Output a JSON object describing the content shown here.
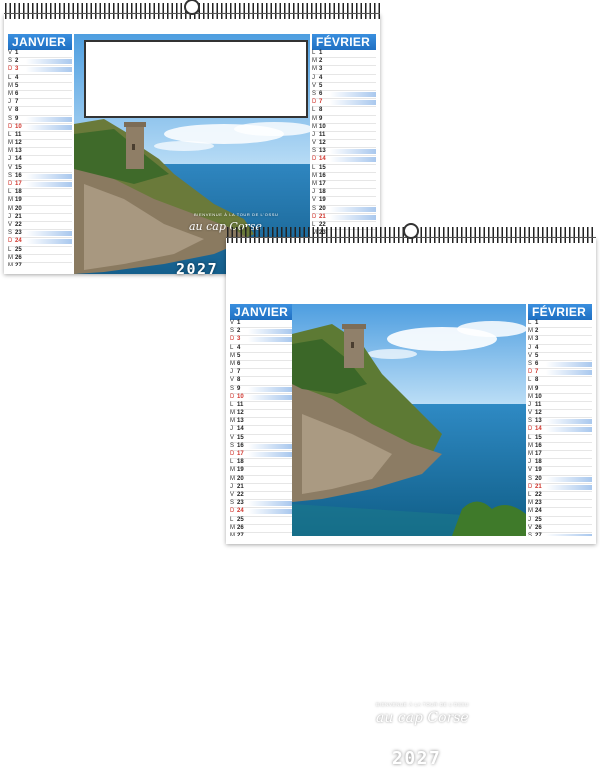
{
  "months": {
    "left": "JANVIER",
    "right": "FÉVRIER"
  },
  "year": "2027",
  "tagline_small": "BIENVENUE À LA TOUR DE L'OSSU",
  "tagline_main": "au cap Corse",
  "colors": {
    "accent": "#2b7fcf",
    "sunday": "#d0342c",
    "sea": "#1f7fae",
    "sky": "#6fb3e6"
  },
  "january_days": [
    {
      "d": "V",
      "n": "1"
    },
    {
      "d": "S",
      "n": "2"
    },
    {
      "d": "D",
      "n": "3"
    },
    {
      "d": "L",
      "n": "4"
    },
    {
      "d": "M",
      "n": "5"
    },
    {
      "d": "M",
      "n": "6"
    },
    {
      "d": "J",
      "n": "7"
    },
    {
      "d": "V",
      "n": "8"
    },
    {
      "d": "S",
      "n": "9"
    },
    {
      "d": "D",
      "n": "10"
    },
    {
      "d": "L",
      "n": "11"
    },
    {
      "d": "M",
      "n": "12"
    },
    {
      "d": "M",
      "n": "13"
    },
    {
      "d": "J",
      "n": "14"
    },
    {
      "d": "V",
      "n": "15"
    },
    {
      "d": "S",
      "n": "16"
    },
    {
      "d": "D",
      "n": "17"
    },
    {
      "d": "L",
      "n": "18"
    },
    {
      "d": "M",
      "n": "19"
    },
    {
      "d": "M",
      "n": "20"
    },
    {
      "d": "J",
      "n": "21"
    },
    {
      "d": "V",
      "n": "22"
    },
    {
      "d": "S",
      "n": "23"
    },
    {
      "d": "D",
      "n": "24"
    },
    {
      "d": "L",
      "n": "25"
    },
    {
      "d": "M",
      "n": "26"
    },
    {
      "d": "M",
      "n": "27"
    },
    {
      "d": "J",
      "n": "28"
    },
    {
      "d": "V",
      "n": "29"
    },
    {
      "d": "S",
      "n": "30"
    },
    {
      "d": "D",
      "n": "31"
    }
  ],
  "february_days": [
    {
      "d": "L",
      "n": "1"
    },
    {
      "d": "M",
      "n": "2"
    },
    {
      "d": "M",
      "n": "3"
    },
    {
      "d": "J",
      "n": "4"
    },
    {
      "d": "V",
      "n": "5"
    },
    {
      "d": "S",
      "n": "6"
    },
    {
      "d": "D",
      "n": "7"
    },
    {
      "d": "L",
      "n": "8"
    },
    {
      "d": "M",
      "n": "9"
    },
    {
      "d": "M",
      "n": "10"
    },
    {
      "d": "J",
      "n": "11"
    },
    {
      "d": "V",
      "n": "12"
    },
    {
      "d": "S",
      "n": "13"
    },
    {
      "d": "D",
      "n": "14"
    },
    {
      "d": "L",
      "n": "15"
    },
    {
      "d": "M",
      "n": "16"
    },
    {
      "d": "M",
      "n": "17"
    },
    {
      "d": "J",
      "n": "18"
    },
    {
      "d": "V",
      "n": "19"
    },
    {
      "d": "S",
      "n": "20"
    },
    {
      "d": "D",
      "n": "21"
    },
    {
      "d": "L",
      "n": "22"
    },
    {
      "d": "M",
      "n": "23"
    },
    {
      "d": "M",
      "n": "24"
    },
    {
      "d": "J",
      "n": "25"
    },
    {
      "d": "V",
      "n": "26"
    },
    {
      "d": "S",
      "n": "27"
    },
    {
      "d": "D",
      "n": "28"
    }
  ]
}
